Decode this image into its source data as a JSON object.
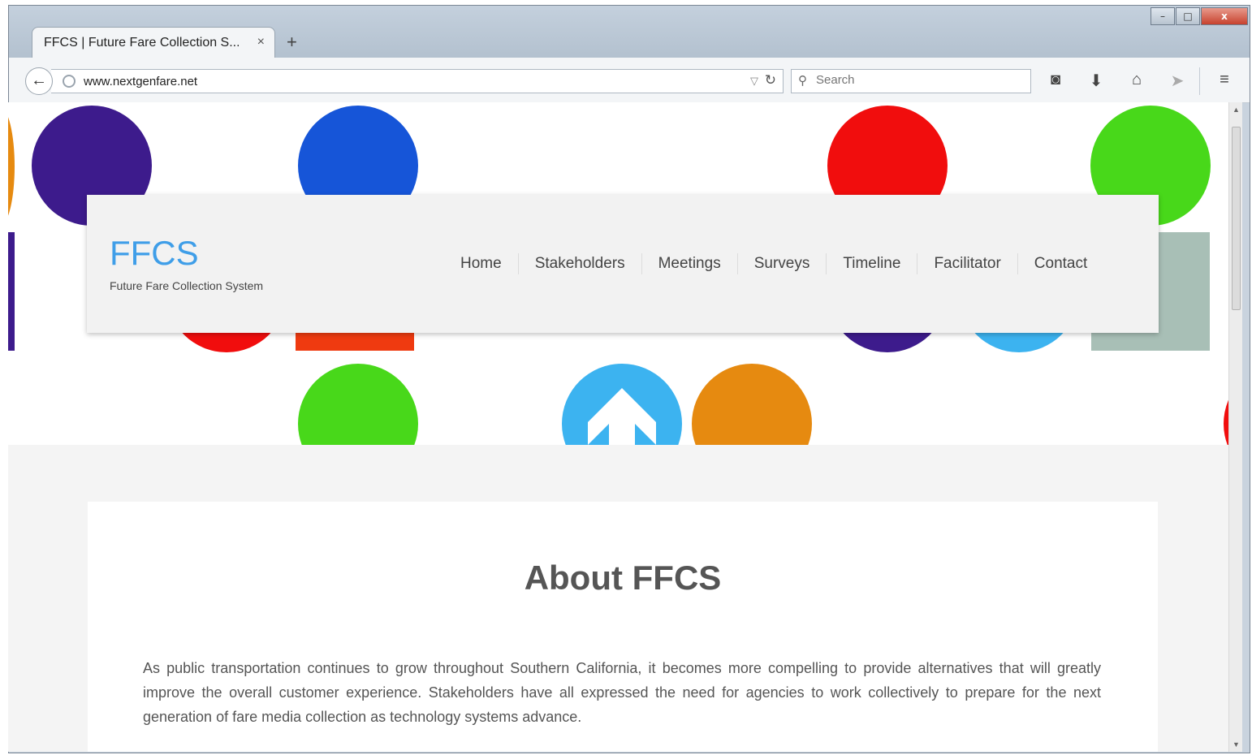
{
  "browser": {
    "tab_title": "FFCS | Future Fare Collection S...",
    "tab_close": "×",
    "new_tab": "+",
    "url": "www.nextgenfare.net",
    "search_placeholder": "Search",
    "window_controls": {
      "minimize": "–",
      "maximize": "□",
      "close": "x"
    }
  },
  "site": {
    "logo": "FFCS",
    "tagline": "Future Fare Collection System",
    "nav": [
      "Home",
      "Stakeholders",
      "Meetings",
      "Surveys",
      "Timeline",
      "Facilitator",
      "Contact"
    ]
  },
  "about": {
    "title": "About FFCS",
    "text": "As public transportation continues to grow throughout Southern California, it becomes more compelling to provide alternatives that will greatly improve the overall customer experience. Stakeholders have all expressed the need for agencies to work collectively to prepare for the next generation of fare media collection as technology systems advance."
  },
  "colors": {
    "brand_blue": "#3f9ee8",
    "dot_purple": "#3d1b8c",
    "dot_blue": "#1655d8",
    "dot_red": "#f10d0d",
    "dot_green": "#48d81a",
    "dot_lightblue": "#3cb3f0",
    "dot_orange": "#e68a10",
    "square_grey": "#a8bfb6"
  }
}
